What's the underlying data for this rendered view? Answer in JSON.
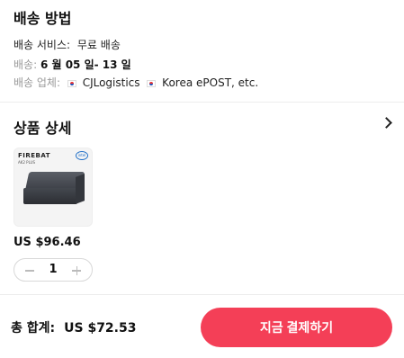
{
  "shipping": {
    "title": "배송 방법",
    "service_label": "배송 서비스:",
    "service_value": "무료 배송",
    "delivery_label": "배송:",
    "delivery_value": "6 월 05 일- 13 일",
    "carrier_label": "배송 업체:",
    "carrier_1": "CJLogistics",
    "carrier_2": "Korea ePOST, etc."
  },
  "details": {
    "title": "상품 상세",
    "product": {
      "brand": "FIREBAT",
      "model": "AK2 PLUS",
      "intel_badge": "intel",
      "price": "US $96.46",
      "quantity": "1"
    }
  },
  "footer": {
    "total_label": "총 합계:",
    "total_amount": "US $72.53",
    "pay_button": "지금 결제하기"
  },
  "colors": {
    "accent": "#f43f57",
    "muted": "#9a9a9a"
  },
  "icons": [
    "chevron-right-icon",
    "flag-kr-icon",
    "minus-icon",
    "plus-icon"
  ]
}
